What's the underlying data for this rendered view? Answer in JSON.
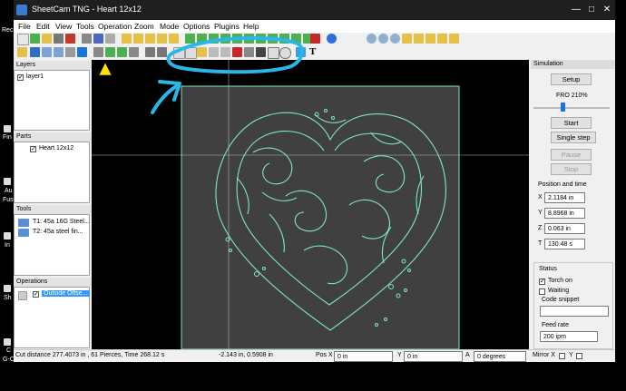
{
  "window": {
    "title": "SheetCam TNG - Heart 12x12"
  },
  "menu": [
    "File",
    "Edit",
    "View",
    "Tools",
    "Operation",
    "Zoom",
    "Mode",
    "Options",
    "Plugins",
    "Help"
  ],
  "layers": {
    "header": "Layers",
    "items": [
      "layer1"
    ]
  },
  "parts": {
    "header": "Parts",
    "items": [
      "Heart 12x12"
    ]
  },
  "tools": {
    "header": "Tools",
    "items": [
      "T1: 45a 16G Steel...",
      "T2: 45a  steel fin..."
    ]
  },
  "operations": {
    "header": "Operations",
    "items": [
      "Outside Offse..."
    ]
  },
  "simulation": {
    "header": "Simulation",
    "setup": "Setup",
    "fro": "FRO 210%",
    "fro_fraction": 0.38,
    "start": "Start",
    "single_step": "Single step",
    "pause": "Pause",
    "stop": "Stop",
    "position_title": "Position and time",
    "x_label": "X",
    "x_value": "2.1184 in",
    "y_label": "Y",
    "y_value": "8.8968 in",
    "z_label": "Z",
    "z_value": "0.063 in",
    "t_label": "T",
    "t_value": "130.48 s"
  },
  "status_panel": {
    "title": "Status",
    "torch_on": "Torch on",
    "waiting": "Waiting",
    "code_snippet": "Code snippet",
    "feed_rate": "Feed rate",
    "feed_value": "200 ipm"
  },
  "statusbar": {
    "cut_info": "Cut distance 277.4073 in , 61 Pierces, Time 268.12 s",
    "coords": "-2.143 in, 0.5908 in",
    "posx_label": "Pos X",
    "posx_value": "0 in",
    "y_label": "Y",
    "y_value": "0 in",
    "a_label": "A",
    "a_value": "0 degrees",
    "mirror_x": "Mirror X",
    "y_check": "Y"
  },
  "desktop": [
    "Rec",
    "Fin",
    "Au",
    "Fus",
    "In",
    "Sh",
    "C",
    "G-Code"
  ],
  "colors": {
    "toolpath": "#7ee8c0",
    "annotation": "#29b6e8",
    "canvas": "#404040",
    "selection": "#3399ff"
  }
}
